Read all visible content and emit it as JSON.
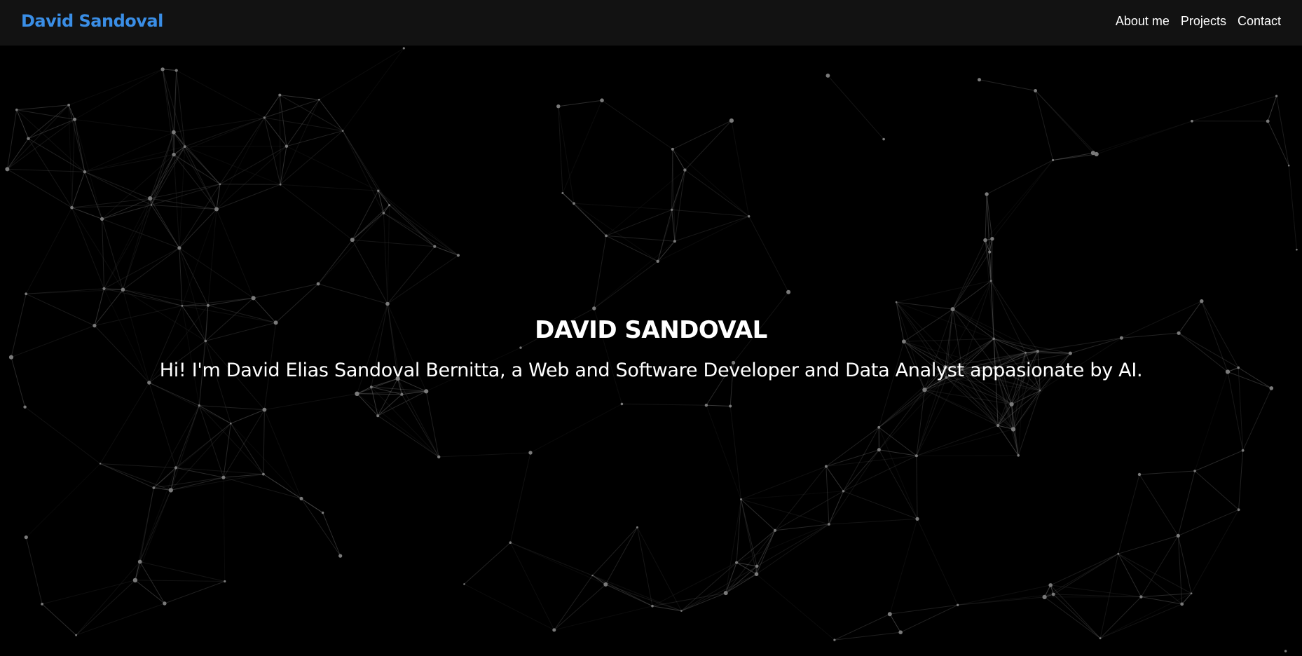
{
  "header": {
    "brand": "David Sandoval",
    "brand_color": "#3a8ee6",
    "background": "#121212",
    "nav": [
      {
        "label": "About me"
      },
      {
        "label": "Projects"
      },
      {
        "label": "Contact"
      }
    ]
  },
  "hero": {
    "title": "DAVID SANDOVAL",
    "subtitle": "Hi! I'm David Elias Sandoval Bernitta, a Web and Software Developer and Data Analyst appasionate by AI."
  },
  "background": {
    "style": "particle-network",
    "color": "#000000",
    "line_color": "#6e6e6e"
  }
}
